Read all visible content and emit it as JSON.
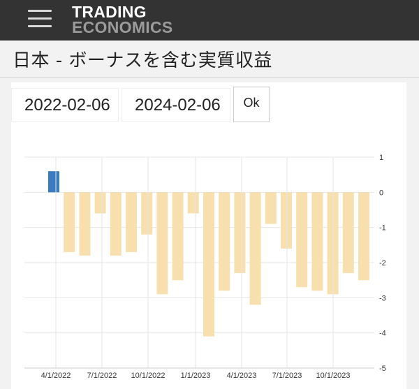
{
  "header": {
    "logo_line1": "TRADING",
    "logo_line2": "ECONOMICS",
    "menu_icon": "hamburger-icon"
  },
  "page": {
    "title": "日本 - ボーナスを含む実質収益"
  },
  "filters": {
    "start_date": "2022-02-06",
    "end_date": "2024-02-06",
    "ok_label": "Ok"
  },
  "colors": {
    "positive_bar": "#3a7cbf",
    "negative_bar": "#f7dfae",
    "grid": "#e6e6e6"
  },
  "chart_data": {
    "type": "bar",
    "title": "",
    "xlabel": "",
    "ylabel": "",
    "ylim": [
      -5,
      1
    ],
    "yticks": [
      1,
      0,
      -1,
      -2,
      -3,
      -4,
      -5
    ],
    "xtick_labels": [
      "4/1/2022",
      "7/1/2022",
      "10/1/2022",
      "1/1/2023",
      "4/1/2023",
      "7/1/2023",
      "10/1/2023"
    ],
    "categories": [
      "2022-02",
      "2022-03",
      "2022-04",
      "2022-05",
      "2022-06",
      "2022-07",
      "2022-08",
      "2022-09",
      "2022-10",
      "2022-11",
      "2022-12",
      "2023-01",
      "2023-02",
      "2023-03",
      "2023-04",
      "2023-05",
      "2023-06",
      "2023-07",
      "2023-08",
      "2023-09",
      "2023-10",
      "2023-11",
      "2023-12"
    ],
    "values": [
      0.6,
      -1.7,
      -1.8,
      -0.6,
      -1.8,
      -1.7,
      -1.2,
      -2.9,
      -2.5,
      -0.6,
      -4.1,
      -2.8,
      -2.3,
      -3.2,
      -0.9,
      -1.6,
      -2.7,
      -2.8,
      -2.9,
      -2.3,
      -2.5
    ],
    "grid": true,
    "legend": "none"
  }
}
